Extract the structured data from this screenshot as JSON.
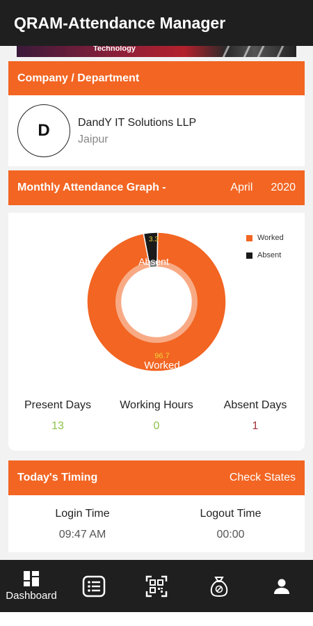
{
  "app": {
    "title": "QRAM-Attendance Manager"
  },
  "banner": {
    "text": "Technology"
  },
  "company": {
    "header": "Company / Department",
    "avatar_letter": "D",
    "name": "DandY IT Solutions LLP",
    "city": "Jaipur"
  },
  "graph": {
    "header": "Monthly Attendance Graph -",
    "month": "April",
    "year": "2020"
  },
  "chart_data": {
    "type": "pie",
    "categories": [
      "Worked",
      "Absent"
    ],
    "values": [
      96.7,
      3.3
    ],
    "slice_labels": [
      "Worked",
      "Absent"
    ],
    "value_labels": [
      "96.7",
      "3.3"
    ],
    "legend": [
      "Worked",
      "Absent"
    ],
    "legend_position": "top-right",
    "colors": {
      "Worked": "#f26522",
      "Absent": "#1a1a1a"
    }
  },
  "stats": [
    {
      "label": "Present Days",
      "value": "13",
      "color": "#8bc34a"
    },
    {
      "label": "Working Hours",
      "value": "0",
      "color": "#8bc34a"
    },
    {
      "label": "Absent Days",
      "value": "1",
      "color": "#a0303a"
    }
  ],
  "timing": {
    "header": "Today's Timing",
    "action": "Check States",
    "login_label": "Login Time",
    "login_value": "09:47 AM",
    "logout_label": "Logout Time",
    "logout_value": "00:00"
  },
  "nav": {
    "items": [
      {
        "label": "Dashboard",
        "icon": "dashboard-icon"
      },
      {
        "label": "",
        "icon": "list-icon"
      },
      {
        "label": "",
        "icon": "qr-code-icon"
      },
      {
        "label": "",
        "icon": "money-bag-icon"
      },
      {
        "label": "",
        "icon": "person-icon"
      }
    ]
  },
  "colors": {
    "accent": "#f26522",
    "dark": "#1f1f1f"
  }
}
